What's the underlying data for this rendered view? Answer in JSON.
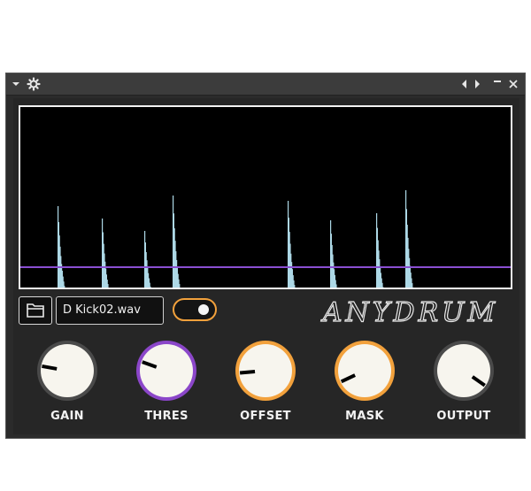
{
  "window": {
    "menu_icon": "chevron-down-icon",
    "settings_icon": "gear-icon",
    "nav_prev_icon": "triangle-left-icon",
    "nav_next_icon": "triangle-right-icon",
    "minimize_icon": "minimize-icon",
    "close_icon": "close-icon"
  },
  "plugin": {
    "logo_text": "ANYDRUM",
    "file_name": "D Kick02.wav",
    "folder_icon": "folder-icon",
    "toggle_on": true,
    "colors": {
      "accent_orange": "#f2a13c",
      "accent_purple": "#8b46c9",
      "waveform": "#add8e6",
      "threshold_line": "#8a4fd1",
      "knob_face": "#f7f5ee"
    }
  },
  "knobs": [
    {
      "label": "GAIN",
      "ring": "grey"
    },
    {
      "label": "THRES",
      "ring": "purple"
    },
    {
      "label": "OFFSET",
      "ring": "orange"
    },
    {
      "label": "MASK",
      "ring": "orange"
    },
    {
      "label": "OUTPUT",
      "ring": "grey"
    }
  ]
}
